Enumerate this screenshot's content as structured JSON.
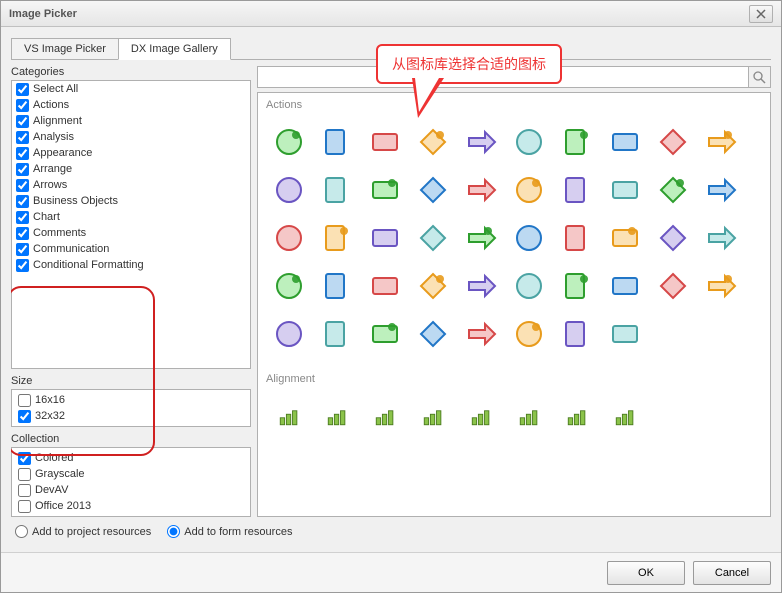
{
  "window": {
    "title": "Image Picker"
  },
  "tabs": {
    "vs": "VS Image Picker",
    "dx": "DX Image Gallery"
  },
  "callout": {
    "text": "从图标库选择合适的图标"
  },
  "labels": {
    "categories": "Categories",
    "size": "Size",
    "collection": "Collection",
    "addProject": "Add to project resources",
    "addForm": "Add to form resources",
    "ok": "OK",
    "cancel": "Cancel"
  },
  "categories": [
    "Select All",
    "Actions",
    "Alignment",
    "Analysis",
    "Appearance",
    "Arrange",
    "Arrows",
    "Business Objects",
    "Chart",
    "Comments",
    "Communication",
    "Conditional Formatting"
  ],
  "sizes": [
    {
      "label": "16x16",
      "checked": false
    },
    {
      "label": "32x32",
      "checked": true
    }
  ],
  "collections": [
    {
      "label": "Colored",
      "checked": true
    },
    {
      "label": "Grayscale",
      "checked": false
    },
    {
      "label": "DevAV",
      "checked": false
    },
    {
      "label": "Office 2013",
      "checked": false
    }
  ],
  "gallery": {
    "groups": {
      "actions": "Actions",
      "alignment": "Alignment"
    },
    "action_icons": [
      "add",
      "add-file",
      "add-page",
      "apply",
      "cancel",
      "clear",
      "calc",
      "grid",
      "arrow-down",
      "delete",
      "refresh",
      "export",
      "remove-row",
      "document",
      "download",
      "download-alt",
      "ab-edit",
      "down",
      "grid-edit",
      "copy",
      "layers",
      "ignore",
      "picture",
      "add-panel",
      "new",
      "folder-open",
      "folder-up",
      "disk",
      "disk-alt",
      "folder-blue",
      "folder-yellow",
      "folder-open-alt",
      "book",
      "undo",
      "redo",
      "minus",
      "collapse",
      "back",
      "forward",
      "goto",
      "select-all",
      "select-region",
      "eye",
      "swap",
      "align",
      "columns",
      "trash",
      "upload"
    ],
    "alignment_icons": [
      "a1",
      "a2",
      "a3",
      "a4",
      "a5",
      "a6",
      "a7",
      "a8"
    ]
  },
  "resourceSelected": "form"
}
